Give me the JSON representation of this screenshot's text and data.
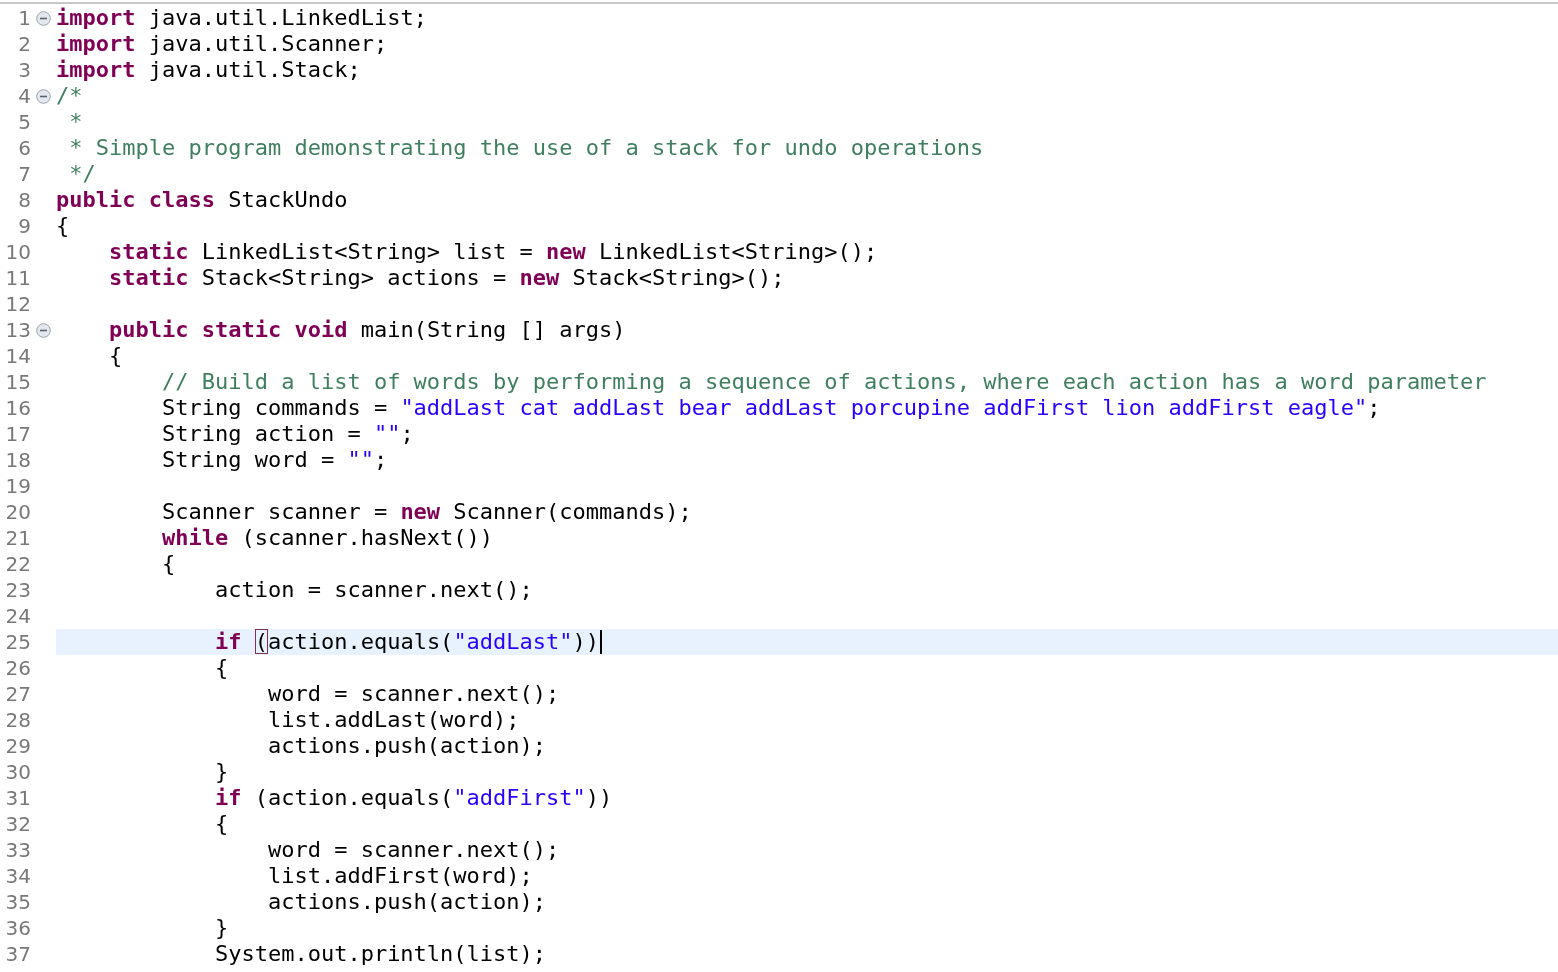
{
  "editor": {
    "lines": [
      {
        "number": "1",
        "expanded": true,
        "current": false,
        "tokens": [
          {
            "kind": "keyword",
            "text": "import"
          },
          {
            "kind": "plain",
            "text": " java.util.LinkedList;"
          }
        ]
      },
      {
        "number": "2",
        "current": false,
        "tokens": [
          {
            "kind": "keyword",
            "text": "import"
          },
          {
            "kind": "plain",
            "text": " java.util.Scanner;"
          }
        ]
      },
      {
        "number": "3",
        "current": false,
        "tokens": [
          {
            "kind": "keyword",
            "text": "import"
          },
          {
            "kind": "plain",
            "text": " java.util.Stack;"
          }
        ]
      },
      {
        "number": "4",
        "expanded": true,
        "current": false,
        "tokens": [
          {
            "kind": "comment",
            "text": "/*"
          }
        ]
      },
      {
        "number": "5",
        "current": false,
        "tokens": [
          {
            "kind": "comment",
            "text": " *"
          }
        ]
      },
      {
        "number": "6",
        "current": false,
        "tokens": [
          {
            "kind": "comment",
            "text": " * Simple program demonstrating the use of a stack for undo operations"
          }
        ]
      },
      {
        "number": "7",
        "current": false,
        "tokens": [
          {
            "kind": "comment",
            "text": " */"
          }
        ]
      },
      {
        "number": "8",
        "current": false,
        "tokens": [
          {
            "kind": "keyword",
            "text": "public class"
          },
          {
            "kind": "plain",
            "text": " StackUndo"
          }
        ]
      },
      {
        "number": "9",
        "current": false,
        "tokens": [
          {
            "kind": "plain",
            "text": "{"
          }
        ]
      },
      {
        "number": "10",
        "current": false,
        "tokens": [
          {
            "kind": "keyword",
            "text": "    static"
          },
          {
            "kind": "plain",
            "text": " LinkedList<String> list = "
          },
          {
            "kind": "keyword",
            "text": "new"
          },
          {
            "kind": "plain",
            "text": " LinkedList<String>();"
          }
        ]
      },
      {
        "number": "11",
        "current": false,
        "tokens": [
          {
            "kind": "keyword",
            "text": "    static"
          },
          {
            "kind": "plain",
            "text": " Stack<String> actions = "
          },
          {
            "kind": "keyword",
            "text": "new"
          },
          {
            "kind": "plain",
            "text": " Stack<String>();"
          }
        ]
      },
      {
        "number": "12",
        "current": false
      },
      {
        "number": "13",
        "expanded": true,
        "current": false,
        "tokens": [
          {
            "kind": "keyword",
            "text": "    public static void"
          },
          {
            "kind": "plain",
            "text": " main(String [] args)"
          }
        ]
      },
      {
        "number": "14",
        "current": false,
        "tokens": [
          {
            "kind": "plain",
            "text": "    {"
          }
        ]
      },
      {
        "number": "15",
        "current": false,
        "tokens": [
          {
            "kind": "comment",
            "text": "        // Build a list of words by performing a sequence of actions, where each action has a word parameter"
          }
        ]
      },
      {
        "number": "16",
        "current": false,
        "tokens": [
          {
            "kind": "plain",
            "text": "        String commands = "
          },
          {
            "kind": "string",
            "text": "\"addLast cat addLast bear addLast porcupine addFirst lion addFirst eagle\""
          },
          {
            "kind": "plain",
            "text": ";"
          }
        ]
      },
      {
        "number": "17",
        "current": false,
        "tokens": [
          {
            "kind": "plain",
            "text": "        String action = "
          },
          {
            "kind": "string",
            "text": "\"\""
          },
          {
            "kind": "plain",
            "text": ";"
          }
        ]
      },
      {
        "number": "18",
        "current": false,
        "tokens": [
          {
            "kind": "plain",
            "text": "        String word = "
          },
          {
            "kind": "string",
            "text": "\"\""
          },
          {
            "kind": "plain",
            "text": ";"
          }
        ]
      },
      {
        "number": "19",
        "current": false
      },
      {
        "number": "20",
        "current": false,
        "tokens": [
          {
            "kind": "plain",
            "text": "        Scanner scanner = "
          },
          {
            "kind": "keyword",
            "text": "new"
          },
          {
            "kind": "plain",
            "text": " Scanner(commands);"
          }
        ]
      },
      {
        "number": "21",
        "current": false,
        "tokens": [
          {
            "kind": "keyword",
            "text": "        while"
          },
          {
            "kind": "plain",
            "text": " (scanner.hasNext())"
          }
        ]
      },
      {
        "number": "22",
        "current": false,
        "tokens": [
          {
            "kind": "plain",
            "text": "        {"
          }
        ]
      },
      {
        "number": "23",
        "current": false,
        "tokens": [
          {
            "kind": "plain",
            "text": "            action = scanner.next();"
          }
        ]
      },
      {
        "number": "24",
        "current": false
      },
      {
        "number": "25",
        "current": true,
        "tokens": [
          {
            "kind": "keyword",
            "text": "            if "
          },
          {
            "kind": "match",
            "text": "("
          },
          {
            "kind": "plain",
            "text": "action.equals("
          },
          {
            "kind": "string",
            "text": "\"addLast\""
          },
          {
            "kind": "plain",
            "text": "))"
          }
        ]
      },
      {
        "number": "26",
        "current": false,
        "tokens": [
          {
            "kind": "plain",
            "text": "            {"
          }
        ]
      },
      {
        "number": "27",
        "current": false,
        "tokens": [
          {
            "kind": "plain",
            "text": "                word = scanner.next();"
          }
        ]
      },
      {
        "number": "28",
        "current": false,
        "tokens": [
          {
            "kind": "plain",
            "text": "                list.addLast(word);"
          }
        ]
      },
      {
        "number": "29",
        "current": false,
        "tokens": [
          {
            "kind": "plain",
            "text": "                actions.push(action);"
          }
        ]
      },
      {
        "number": "30",
        "current": false,
        "tokens": [
          {
            "kind": "plain",
            "text": "            }"
          }
        ]
      },
      {
        "number": "31",
        "current": false,
        "tokens": [
          {
            "kind": "keyword",
            "text": "            if"
          },
          {
            "kind": "plain",
            "text": " (action.equals("
          },
          {
            "kind": "string",
            "text": "\"addFirst\""
          },
          {
            "kind": "plain",
            "text": "))"
          }
        ]
      },
      {
        "number": "32",
        "current": false,
        "tokens": [
          {
            "kind": "plain",
            "text": "            {"
          }
        ]
      },
      {
        "number": "33",
        "current": false,
        "tokens": [
          {
            "kind": "plain",
            "text": "                word = scanner.next();"
          }
        ]
      },
      {
        "number": "34",
        "current": false,
        "tokens": [
          {
            "kind": "plain",
            "text": "                list.addFirst(word);"
          }
        ]
      },
      {
        "number": "35",
        "current": false,
        "tokens": [
          {
            "kind": "plain",
            "text": "                actions.push(action);"
          }
        ]
      },
      {
        "number": "36",
        "current": false,
        "tokens": [
          {
            "kind": "plain",
            "text": "            }"
          }
        ]
      },
      {
        "number": "37",
        "current": false,
        "tokens": [
          {
            "kind": "plain",
            "text": "            System.out.println(list);"
          }
        ]
      }
    ]
  }
}
